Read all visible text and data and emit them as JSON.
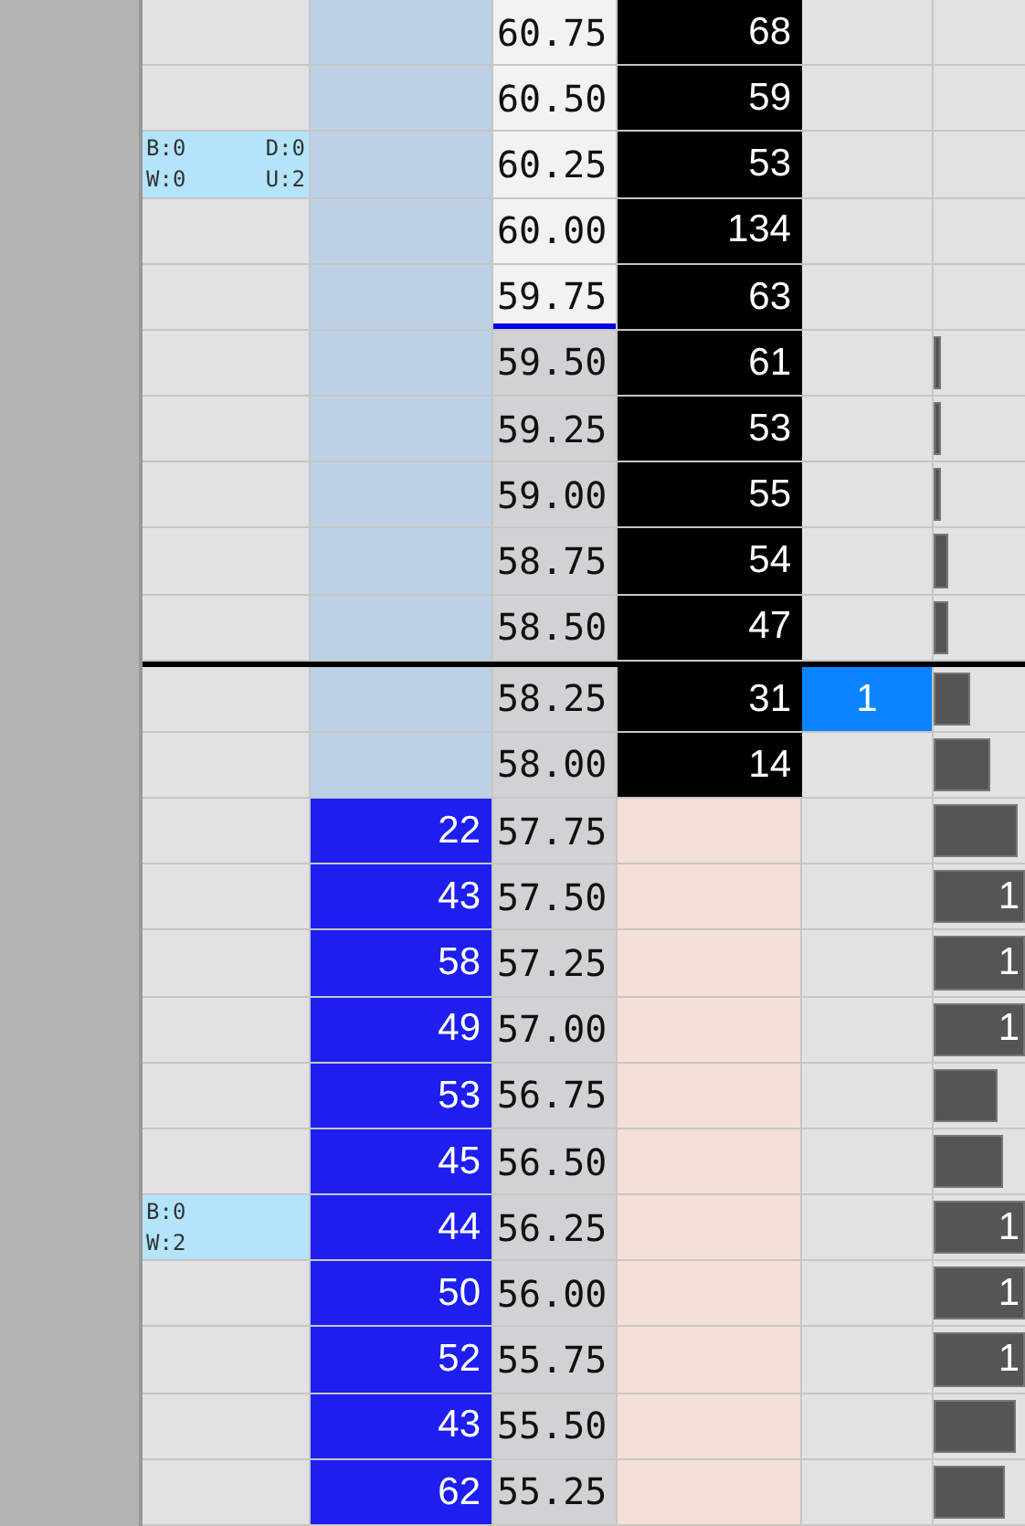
{
  "rows": [
    {
      "kind": "ask",
      "price": "60.75",
      "size": "68",
      "light": true,
      "marked": false,
      "break": false
    },
    {
      "kind": "ask",
      "price": "60.50",
      "size": "59",
      "light": true,
      "marked": false,
      "break": false
    },
    {
      "kind": "ask",
      "price": "60.25",
      "size": "53",
      "light": true,
      "marked": false,
      "break": false,
      "note": {
        "lines": [
          {
            "left": "B:0",
            "right": "D:0"
          },
          {
            "left": "W:0",
            "right": "U:2"
          }
        ]
      }
    },
    {
      "kind": "ask",
      "price": "60.00",
      "size": "134",
      "light": true,
      "marked": false,
      "break": false
    },
    {
      "kind": "ask",
      "price": "59.75",
      "size": "63",
      "light": true,
      "marked": true,
      "break": false
    },
    {
      "kind": "ask",
      "price": "59.50",
      "size": "61",
      "light": false,
      "marked": false,
      "break": false,
      "volume": {
        "level": 0.02
      }
    },
    {
      "kind": "ask",
      "price": "59.25",
      "size": "53",
      "light": false,
      "marked": false,
      "break": false,
      "volume": {
        "level": 0.04
      }
    },
    {
      "kind": "ask",
      "price": "59.00",
      "size": "55",
      "light": false,
      "marked": false,
      "break": false,
      "volume": {
        "level": 0.08
      }
    },
    {
      "kind": "ask",
      "price": "58.75",
      "size": "54",
      "light": false,
      "marked": false,
      "break": false,
      "volume": {
        "level": 0.15
      }
    },
    {
      "kind": "ask",
      "price": "58.50",
      "size": "47",
      "light": false,
      "marked": false,
      "break": false,
      "volume": {
        "level": 0.15
      }
    },
    {
      "kind": "ask",
      "price": "58.25",
      "size": "31",
      "light": false,
      "marked": false,
      "break": true,
      "order": "1",
      "volume": {
        "level": 0.4
      }
    },
    {
      "kind": "ask",
      "price": "58.00",
      "size": "14",
      "light": false,
      "marked": false,
      "break": false,
      "volume": {
        "level": 0.62
      }
    },
    {
      "kind": "bid",
      "price": "57.75",
      "size": "22",
      "light": false,
      "marked": false,
      "break": false,
      "volume": {
        "level": 0.92
      }
    },
    {
      "kind": "bid",
      "price": "57.50",
      "size": "43",
      "light": false,
      "marked": false,
      "break": false,
      "volume": {
        "level": 1,
        "text": "1"
      }
    },
    {
      "kind": "bid",
      "price": "57.25",
      "size": "58",
      "light": false,
      "marked": false,
      "break": false,
      "volume": {
        "level": 1,
        "text": "1"
      }
    },
    {
      "kind": "bid",
      "price": "57.00",
      "size": "49",
      "light": false,
      "marked": false,
      "break": false,
      "volume": {
        "level": 1,
        "text": "1"
      }
    },
    {
      "kind": "bid",
      "price": "56.75",
      "size": "53",
      "light": false,
      "marked": false,
      "break": false,
      "volume": {
        "level": 0.7
      }
    },
    {
      "kind": "bid",
      "price": "56.50",
      "size": "45",
      "light": false,
      "marked": false,
      "break": false,
      "volume": {
        "level": 0.75
      }
    },
    {
      "kind": "bid",
      "price": "56.25",
      "size": "44",
      "light": false,
      "marked": false,
      "break": false,
      "volume": {
        "level": 1,
        "text": "1"
      },
      "note": {
        "lines": [
          {
            "left": "B:0"
          },
          {
            "left": "W:2"
          }
        ]
      }
    },
    {
      "kind": "bid",
      "price": "56.00",
      "size": "50",
      "light": false,
      "marked": false,
      "break": false,
      "volume": {
        "level": 1,
        "text": "1"
      }
    },
    {
      "kind": "bid",
      "price": "55.75",
      "size": "52",
      "light": false,
      "marked": false,
      "break": false,
      "volume": {
        "level": 1,
        "text": "1"
      }
    },
    {
      "kind": "bid",
      "price": "55.50",
      "size": "43",
      "light": false,
      "marked": false,
      "break": false,
      "volume": {
        "level": 0.9
      }
    },
    {
      "kind": "bid",
      "price": "55.25",
      "size": "62",
      "light": false,
      "marked": false,
      "break": false,
      "volume": {
        "level": 0.77
      }
    }
  ]
}
